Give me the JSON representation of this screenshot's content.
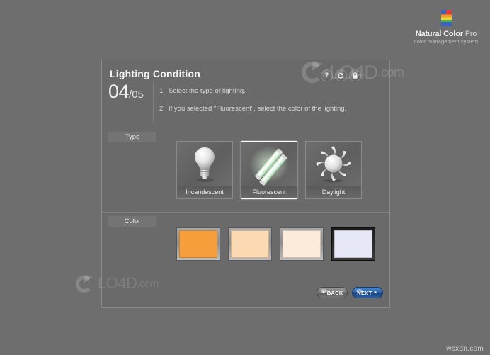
{
  "brand": {
    "logo_icon": "rainbow-square-orbit-icon",
    "name_bold": "Natural Color",
    "name_light": " Pro",
    "subtitle": "color management system"
  },
  "panel": {
    "title": "Lighting Condition",
    "step_current": "04",
    "step_total": "/05",
    "instructions": [
      {
        "num": "1.",
        "text": "Select the type of lighting."
      },
      {
        "num": "2.",
        "text": "If you selected \"Fluorescent\", select the color of the lighting."
      }
    ],
    "icon_buttons": [
      {
        "name": "help-icon",
        "glyph": "?"
      },
      {
        "name": "minimize-icon",
        "glyph": "–"
      },
      {
        "name": "lock-icon",
        "glyph": "🔒"
      }
    ]
  },
  "type_section": {
    "label": "Type",
    "tiles": [
      {
        "label": "Incandescent",
        "icon": "light-bulb-icon",
        "selected": false
      },
      {
        "label": "Fluorescent",
        "icon": "fluorescent-tube-icon",
        "selected": true
      },
      {
        "label": "Daylight",
        "icon": "sun-icon",
        "selected": false
      }
    ]
  },
  "color_section": {
    "label": "Color",
    "swatches": [
      {
        "name": "color-swatch-orange",
        "color": "#F79E3D",
        "selected": false
      },
      {
        "name": "color-swatch-light-peach",
        "color": "#FBD9B2",
        "selected": false
      },
      {
        "name": "color-swatch-cream",
        "color": "#FCEADA",
        "selected": false
      },
      {
        "name": "color-swatch-cool-white",
        "color": "#E6E8F8",
        "selected": true
      }
    ]
  },
  "nav": {
    "back_label": "BACK",
    "back_arrow": "◄",
    "next_label": "NEXT",
    "next_arrow": "►"
  },
  "watermarks": {
    "top": {
      "text": "LO4D",
      "suffix": ".com"
    },
    "bottom": {
      "text": "LO4D",
      "suffix": ".com"
    }
  },
  "footer": {
    "credit": "wsxdn.com"
  }
}
